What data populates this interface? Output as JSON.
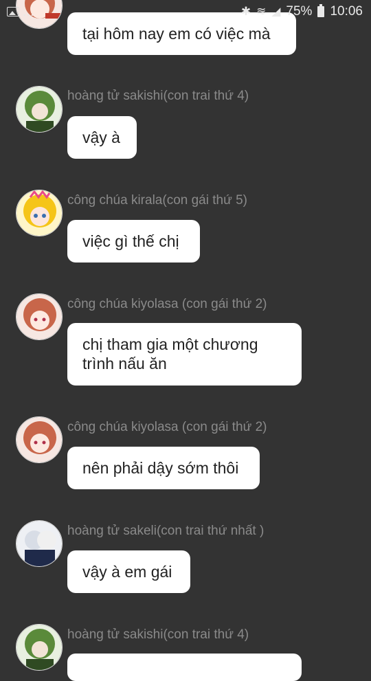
{
  "status_bar": {
    "left_icons": [
      "gallery-icon",
      "dots-icon"
    ],
    "right_icons": [
      "bluetooth-icon",
      "wifi-icon",
      "signal-icon",
      "battery-icon"
    ],
    "battery": "75%",
    "time": "10:06"
  },
  "messages": [
    {
      "sender": "",
      "text_lines": [
        "tại hôm nay em có việc mà"
      ],
      "avatar": "kiyolasa-avatar"
    },
    {
      "sender": "hoàng tử sakishi(con trai thứ 4)",
      "text_lines": [
        "vậy à"
      ],
      "avatar": "sakishi-avatar"
    },
    {
      "sender": "công chúa kirala(con gái thứ 5)",
      "text_lines": [
        "việc gì thế chị"
      ],
      "avatar": "kirala-avatar"
    },
    {
      "sender": "công chúa kiyolasa (con gái  thứ 2)",
      "text_lines": [
        "chị tham gia một chương",
        "trình nấu ăn"
      ],
      "avatar": "kiyolasa-avatar"
    },
    {
      "sender": "công chúa kiyolasa (con gái  thứ 2)",
      "text_lines": [
        "nên phải dậy sớm thôi"
      ],
      "avatar": "kiyolasa-avatar"
    },
    {
      "sender": "hoàng tử sakeli(con trai thứ nhất )",
      "text_lines": [
        "vậy à em gái"
      ],
      "avatar": "sakeli-avatar"
    },
    {
      "sender": "hoàng tử sakishi(con trai thứ 4)",
      "text_lines": [
        ""
      ],
      "avatar": "sakishi-avatar"
    }
  ],
  "colors": {
    "background": "#333333",
    "bubble": "#ffffff",
    "sender": "#8a8a8a"
  }
}
